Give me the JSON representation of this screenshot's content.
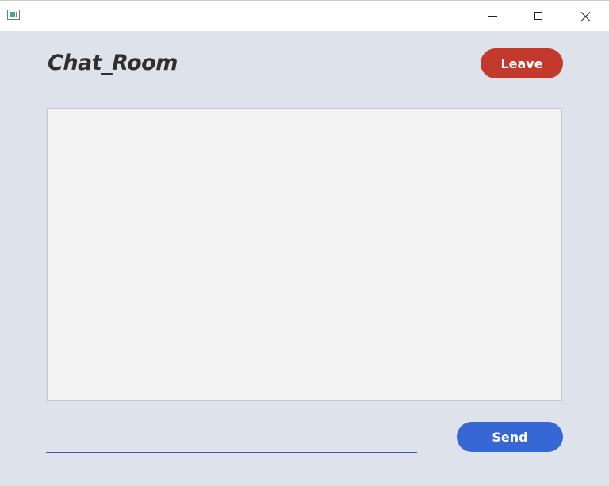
{
  "window": {
    "icon": "app-window-icon",
    "controls": {
      "minimize_icon": "minimize-icon",
      "maximize_icon": "maximize-icon",
      "close_icon": "close-icon"
    }
  },
  "header": {
    "title": "Chat_Room",
    "leave_label": "Leave"
  },
  "chat": {
    "messages": []
  },
  "composer": {
    "input_value": "",
    "input_placeholder": "",
    "send_label": "Send"
  },
  "colors": {
    "background": "#dee2ea",
    "leave_button": "#c33a2c",
    "send_button": "#3767d4",
    "input_underline": "#3a55b3",
    "message_area": "#f3f3f3"
  }
}
